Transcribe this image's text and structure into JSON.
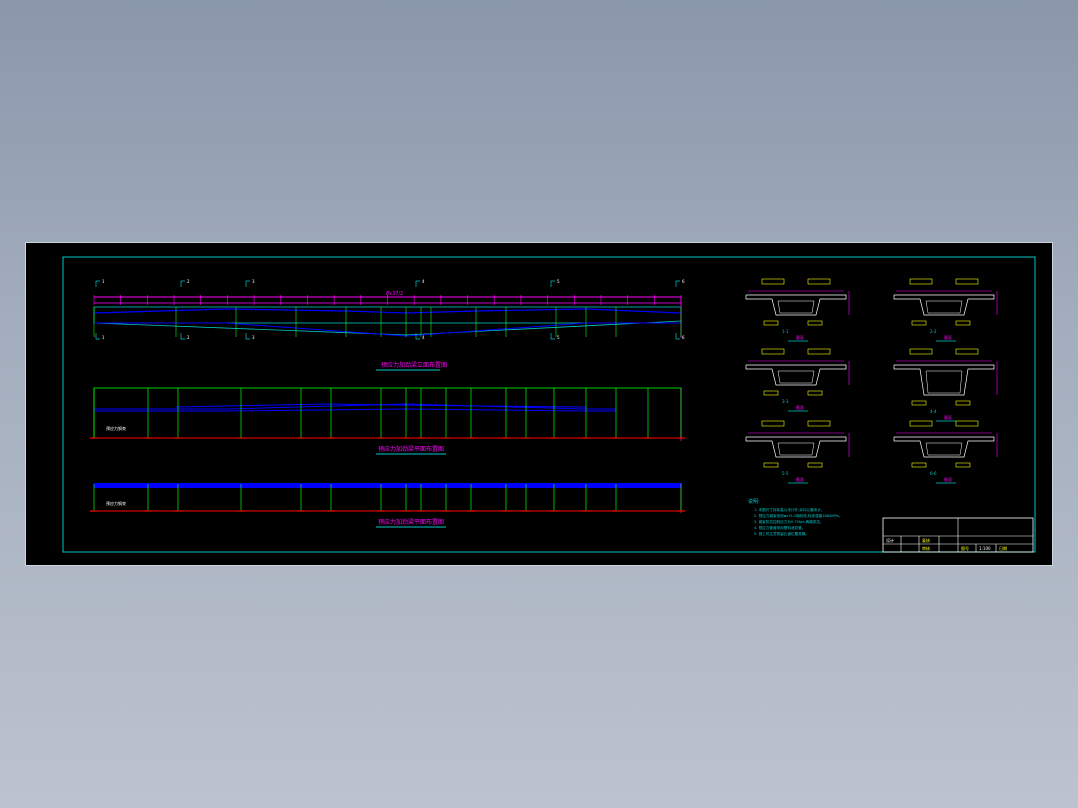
{
  "colors": {
    "background": "#000000",
    "frame": "#00c8c8",
    "dimension": "#ff00ff",
    "girder_line": "#00ff00",
    "tendon": "#0000ff",
    "support": "#ff0000",
    "label": "#ffff00",
    "text": "#ffffff"
  },
  "elevation": {
    "span_dim": "8x37/2",
    "section_marks": [
      "1",
      "2",
      "3",
      "4",
      "5",
      "6"
    ],
    "title": "预应力加劲梁立面布置图"
  },
  "plan_top": {
    "title": "预应力加劲梁平面布置图",
    "note": "预应力钢束"
  },
  "plan_bottom": {
    "title": "预应力加劲梁平面布置图",
    "note": "预应力钢束"
  },
  "sections": [
    {
      "label": "1-1",
      "caption": "截面"
    },
    {
      "label": "2-2",
      "caption": "截面"
    },
    {
      "label": "3-3",
      "caption": "截面"
    },
    {
      "label": "4-4",
      "caption": "截面"
    },
    {
      "label": "5-5",
      "caption": "截面"
    },
    {
      "label": "6-6",
      "caption": "截面"
    }
  ],
  "notes": {
    "heading": "说明:",
    "lines": [
      "1. 本图尺寸除标高以米计外,余均以厘米计。",
      "2. 预应力钢束采用φs15.2钢绞线,标准强度1860MPa。",
      "3. 钢束张拉控制应力为0.75fpk,两端张拉。",
      "4. 预应力管道采用塑料波纹管。",
      "5. 施工时注意预留孔道位置准确。"
    ]
  },
  "title_block": {
    "designer": "设计",
    "checker": "复核",
    "reviewer": "审核",
    "drawing_no": "图号",
    "scale": "1:100",
    "date": "日期"
  }
}
